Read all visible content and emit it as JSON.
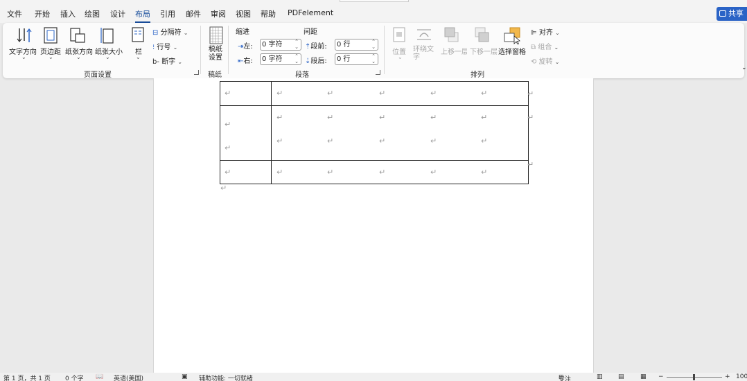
{
  "menu": {
    "tabs": [
      {
        "label": "文件"
      },
      {
        "label": "开始"
      },
      {
        "label": "插入"
      },
      {
        "label": "绘图"
      },
      {
        "label": "设计"
      },
      {
        "label": "布局"
      },
      {
        "label": "引用"
      },
      {
        "label": "邮件"
      },
      {
        "label": "审阅"
      },
      {
        "label": "视图"
      },
      {
        "label": "帮助"
      },
      {
        "label": "PDFelement"
      }
    ],
    "active_tab": "布局",
    "share_label": "共享"
  },
  "ribbon": {
    "page_setup": {
      "text_direction": "文字方向",
      "margins": "页边距",
      "orientation": "纸张方向",
      "size": "纸张大小",
      "columns": "栏",
      "breaks": "分隔符",
      "line_numbers": "行号",
      "hyphenation": "断字",
      "group_label": "页面设置"
    },
    "manuscript": {
      "button": "稿纸\n设置",
      "group_label": "稿纸"
    },
    "paragraph": {
      "indent_header": "缩进",
      "spacing_header": "间距",
      "left_label": "左:",
      "right_label": "右:",
      "left_value": "0 字符",
      "right_value": "0 字符",
      "before_label": "段前:",
      "after_label": "段后:",
      "before_value": "0 行",
      "after_value": "0 行",
      "group_label": "段落"
    },
    "arrange": {
      "position": "位置",
      "wrap_text": "环绕文\n字",
      "bring_forward": "上移一层",
      "send_backward": "下移一层",
      "selection_pane": "选择窗格",
      "align": "对齐",
      "group": "组合",
      "rotate": "旋转",
      "group_label": "排列"
    }
  },
  "document": {
    "paragraph_mark": "↵"
  },
  "status_bar": {
    "page": "第 1 页，共 1 页",
    "words": "0 个字",
    "language": "英语(美国)",
    "accessibility": "辅助功能: 一切就绪",
    "focus": "专注",
    "zoom": "100"
  },
  "colors": {
    "accent": "#1a4f9c",
    "share": "#2a63c6",
    "selection_pane_icon": "#f2b84b"
  }
}
